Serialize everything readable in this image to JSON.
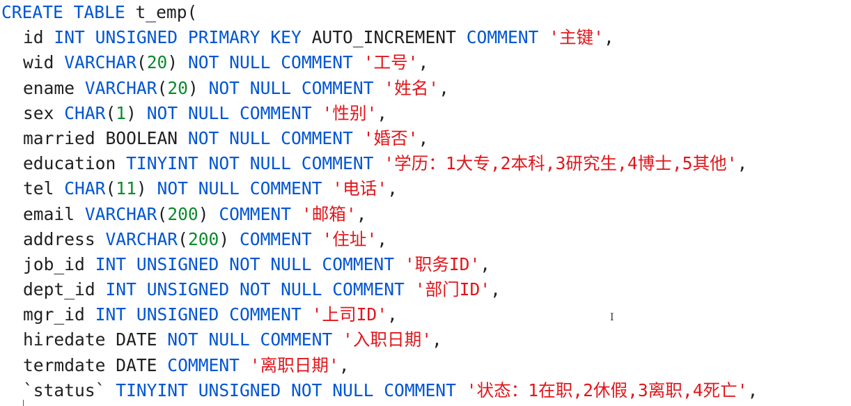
{
  "editor": {
    "lines": [
      {
        "tokens": [
          {
            "t": "kw",
            "v": "CREATE TABLE"
          },
          {
            "t": "id",
            "v": " t_emp("
          }
        ]
      },
      {
        "indent": true,
        "tokens": [
          {
            "t": "id",
            "v": "id "
          },
          {
            "t": "kw",
            "v": "INT UNSIGNED PRIMARY KEY"
          },
          {
            "t": "id",
            "v": " AUTO_INCREMENT "
          },
          {
            "t": "kw",
            "v": "COMMENT"
          },
          {
            "t": "id",
            "v": " "
          },
          {
            "t": "str",
            "v": "'主键'"
          },
          {
            "t": "pun",
            "v": ","
          }
        ]
      },
      {
        "indent": true,
        "tokens": [
          {
            "t": "id",
            "v": "wid "
          },
          {
            "t": "kw",
            "v": "VARCHAR"
          },
          {
            "t": "pun",
            "v": "("
          },
          {
            "t": "num",
            "v": "20"
          },
          {
            "t": "pun",
            "v": ") "
          },
          {
            "t": "kw",
            "v": "NOT NULL COMMENT"
          },
          {
            "t": "id",
            "v": " "
          },
          {
            "t": "str",
            "v": "'工号'"
          },
          {
            "t": "pun",
            "v": ","
          }
        ]
      },
      {
        "indent": true,
        "tokens": [
          {
            "t": "id",
            "v": "ename "
          },
          {
            "t": "kw",
            "v": "VARCHAR"
          },
          {
            "t": "pun",
            "v": "("
          },
          {
            "t": "num",
            "v": "20"
          },
          {
            "t": "pun",
            "v": ") "
          },
          {
            "t": "kw",
            "v": "NOT NULL COMMENT"
          },
          {
            "t": "id",
            "v": " "
          },
          {
            "t": "str",
            "v": "'姓名'"
          },
          {
            "t": "pun",
            "v": ","
          }
        ]
      },
      {
        "indent": true,
        "tokens": [
          {
            "t": "id",
            "v": "sex "
          },
          {
            "t": "kw",
            "v": "CHAR"
          },
          {
            "t": "pun",
            "v": "("
          },
          {
            "t": "num",
            "v": "1"
          },
          {
            "t": "pun",
            "v": ") "
          },
          {
            "t": "kw",
            "v": "NOT NULL COMMENT"
          },
          {
            "t": "id",
            "v": " "
          },
          {
            "t": "str",
            "v": "'性别'"
          },
          {
            "t": "pun",
            "v": ","
          }
        ]
      },
      {
        "indent": true,
        "tokens": [
          {
            "t": "id",
            "v": "married BOOLEAN "
          },
          {
            "t": "kw",
            "v": "NOT NULL COMMENT"
          },
          {
            "t": "id",
            "v": " "
          },
          {
            "t": "str",
            "v": "'婚否'"
          },
          {
            "t": "pun",
            "v": ","
          }
        ]
      },
      {
        "indent": true,
        "tokens": [
          {
            "t": "id",
            "v": "education "
          },
          {
            "t": "kw",
            "v": "TINYINT NOT NULL COMMENT"
          },
          {
            "t": "id",
            "v": " "
          },
          {
            "t": "str",
            "v": "'学历：1大专,2本科,3研究生,4博士,5其他'"
          },
          {
            "t": "pun",
            "v": ","
          }
        ]
      },
      {
        "indent": true,
        "tokens": [
          {
            "t": "id",
            "v": "tel "
          },
          {
            "t": "kw",
            "v": "CHAR"
          },
          {
            "t": "pun",
            "v": "("
          },
          {
            "t": "num",
            "v": "11"
          },
          {
            "t": "pun",
            "v": ") "
          },
          {
            "t": "kw",
            "v": "NOT NULL COMMENT"
          },
          {
            "t": "id",
            "v": " "
          },
          {
            "t": "str",
            "v": "'电话'"
          },
          {
            "t": "pun",
            "v": ","
          }
        ]
      },
      {
        "indent": true,
        "tokens": [
          {
            "t": "id",
            "v": "email "
          },
          {
            "t": "kw",
            "v": "VARCHAR"
          },
          {
            "t": "pun",
            "v": "("
          },
          {
            "t": "num",
            "v": "200"
          },
          {
            "t": "pun",
            "v": ") "
          },
          {
            "t": "kw",
            "v": "COMMENT"
          },
          {
            "t": "id",
            "v": " "
          },
          {
            "t": "str",
            "v": "'邮箱'"
          },
          {
            "t": "pun",
            "v": ","
          }
        ]
      },
      {
        "indent": true,
        "tokens": [
          {
            "t": "id",
            "v": "address "
          },
          {
            "t": "kw",
            "v": "VARCHAR"
          },
          {
            "t": "pun",
            "v": "("
          },
          {
            "t": "num",
            "v": "200"
          },
          {
            "t": "pun",
            "v": ") "
          },
          {
            "t": "kw",
            "v": "COMMENT"
          },
          {
            "t": "id",
            "v": " "
          },
          {
            "t": "str",
            "v": "'住址'"
          },
          {
            "t": "pun",
            "v": ","
          }
        ]
      },
      {
        "indent": true,
        "tokens": [
          {
            "t": "id",
            "v": "job_id "
          },
          {
            "t": "kw",
            "v": "INT UNSIGNED NOT NULL COMMENT"
          },
          {
            "t": "id",
            "v": " "
          },
          {
            "t": "str",
            "v": "'职务ID'"
          },
          {
            "t": "pun",
            "v": ","
          }
        ]
      },
      {
        "indent": true,
        "tokens": [
          {
            "t": "id",
            "v": "dept_id "
          },
          {
            "t": "kw",
            "v": "INT UNSIGNED NOT NULL COMMENT"
          },
          {
            "t": "id",
            "v": " "
          },
          {
            "t": "str",
            "v": "'部门ID'"
          },
          {
            "t": "pun",
            "v": ","
          }
        ]
      },
      {
        "indent": true,
        "tokens": [
          {
            "t": "id",
            "v": "mgr_id "
          },
          {
            "t": "kw",
            "v": "INT UNSIGNED COMMENT"
          },
          {
            "t": "id",
            "v": " "
          },
          {
            "t": "str",
            "v": "'上司ID'"
          },
          {
            "t": "pun",
            "v": ","
          }
        ]
      },
      {
        "indent": true,
        "tokens": [
          {
            "t": "id",
            "v": "hiredate DATE "
          },
          {
            "t": "kw",
            "v": "NOT NULL COMMENT"
          },
          {
            "t": "id",
            "v": " "
          },
          {
            "t": "str",
            "v": "'入职日期'"
          },
          {
            "t": "pun",
            "v": ","
          }
        ]
      },
      {
        "indent": true,
        "tokens": [
          {
            "t": "id",
            "v": "termdate DATE "
          },
          {
            "t": "kw",
            "v": "COMMENT"
          },
          {
            "t": "id",
            "v": " "
          },
          {
            "t": "str",
            "v": "'离职日期'"
          },
          {
            "t": "pun",
            "v": ","
          }
        ]
      },
      {
        "indent": true,
        "tokens": [
          {
            "t": "id",
            "v": "`status` "
          },
          {
            "t": "kw",
            "v": "TINYINT UNSIGNED NOT NULL COMMENT"
          },
          {
            "t": "id",
            "v": " "
          },
          {
            "t": "str",
            "v": "'状态：1在职,2休假,3离职,4死亡'"
          },
          {
            "t": "pun",
            "v": ","
          }
        ]
      }
    ]
  },
  "colors": {
    "keyword": "#0055d4",
    "number": "#0b8a2b",
    "string": "#e0161b",
    "identifier": "#1f1f1f"
  },
  "icons": {
    "mouse_cursor": "text-ibeam-icon"
  }
}
